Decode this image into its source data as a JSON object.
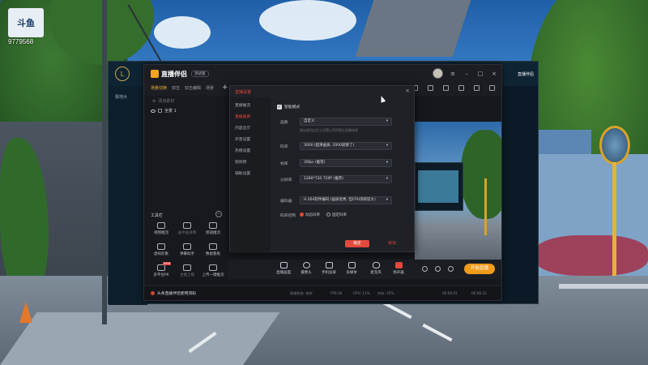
{
  "watermark": {
    "logo_text": "斗鱼",
    "room_id": "9779568"
  },
  "background_window": {
    "title_right_1": "直播伴侣",
    "title_right_2": "",
    "sub_item": "极地大"
  },
  "app": {
    "name": "直播伴侣",
    "version_badge": "测试版",
    "scene_tabs": [
      "场景切换",
      "双击",
      "双击编辑",
      "场景"
    ],
    "add_tab": "+",
    "add_source": "添加素材",
    "source_item": "全景 1",
    "tools_header": "工具栏",
    "tools_toggle": "−",
    "tools": [
      {
        "label": "视频推流",
        "dim": false
      },
      {
        "label": "画中画录制",
        "dim": true
      },
      {
        "label": "频道推流",
        "dim": false
      },
      {
        "label": "虚拟形象",
        "dim": false
      },
      {
        "label": "弹幕助手",
        "dim": false
      },
      {
        "label": "数据看板",
        "dim": false
      },
      {
        "label": "多平台PK",
        "dim": false,
        "hot": "NEW"
      },
      {
        "label": "主播上播",
        "dim": true
      },
      {
        "label": "上传一键推流",
        "dim": false
      },
      {
        "label": "插件库",
        "dim": true
      }
    ],
    "bottom_toolbar": [
      "直播画面",
      "摄像头",
      "手机投屏",
      "多媒体",
      "麦克风",
      "扬声器"
    ],
    "go_live": "开始直播",
    "status_message": "头条直播伴侣使用须知",
    "stats": [
      "网络状态: 良好",
      "FPS:30",
      "CPU: 11%",
      "内存: 25%",
      "00:00:01",
      "00:06:33"
    ]
  },
  "dialog": {
    "title": "直播设置",
    "close": "×",
    "nav": [
      "直播推流",
      "直播画质",
      "内容显示",
      "声音设置",
      "热键设置",
      "短视频",
      "辅助设置"
    ],
    "nav_active_index": 1,
    "smart_mode_label": "智能模式",
    "smart_mode_checked": true,
    "fields": [
      {
        "label": "画质",
        "value": "自定义"
      },
      {
        "label": "码率",
        "value": "3000 (超清画质, 2000就够了)"
      },
      {
        "label": "帧率",
        "value": "30fps (推荐)"
      },
      {
        "label": "分辨率",
        "value": "1280*720 720P (推荐)"
      },
      {
        "label": "编码器",
        "value": "H.264软件编码 (画质优秀, 但CPU消耗较大)"
      }
    ],
    "hint": "建议使用自定义设置以获得更佳直播效果",
    "rate_control_label": "码率控制",
    "rate_options": [
      "动态码率",
      "固定码率"
    ],
    "rate_selected_index": 0,
    "ok": "确定",
    "cancel": "取消"
  },
  "colors": {
    "accent": "#e24a3c",
    "live_orange": "#f29a1a",
    "app_bg": "#16181d"
  }
}
